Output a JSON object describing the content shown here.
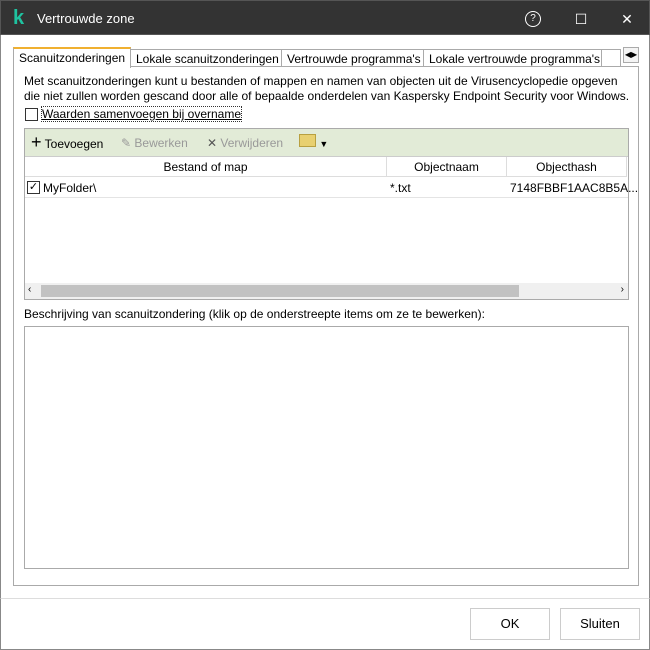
{
  "window": {
    "title": "Vertrouwde zone",
    "logo": "k",
    "help_icon": "?",
    "maximize_icon": "☐",
    "close_icon": "✕"
  },
  "tabs": [
    {
      "label": "Scanuitzonderingen",
      "active": true
    },
    {
      "label": "Lokale scanuitzonderingen"
    },
    {
      "label": "Vertrouwde programma's"
    },
    {
      "label": "Lokale vertrouwde programma's"
    }
  ],
  "description": "Met scanuitzonderingen kunt u bestanden of mappen en namen van objecten uit de Virusencyclopedie opgeven die niet zullen worden gescand door alle of bepaalde onderdelen van Kaspersky Endpoint Security voor Windows.",
  "merge_checkbox": {
    "label": "Waarden samenvoegen bij overname",
    "checked": false
  },
  "toolbar": {
    "add": "Toevoegen",
    "edit": "Bewerken",
    "delete": "Verwijderen"
  },
  "table": {
    "columns": [
      "Bestand of map",
      "Objectnaam",
      "Objecthash"
    ],
    "rows": [
      {
        "checked": true,
        "file": "MyFolder\\",
        "object": "*.txt",
        "hash": "7148FBBF1AAC8B5A..."
      }
    ]
  },
  "details_label": "Beschrijving van scanuitzondering (klik op de onderstreepte items om ze te bewerken):",
  "footer": {
    "ok": "OK",
    "close": "Sluiten"
  }
}
